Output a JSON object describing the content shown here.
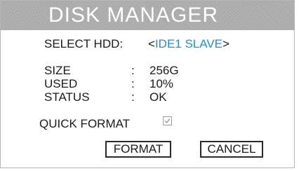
{
  "title": "DISK MANAGER",
  "select_hdd": {
    "label": "SELECT HDD:",
    "bracket_open": "<",
    "value": "IDE1 SLAVE",
    "bracket_close": ">"
  },
  "info": [
    {
      "label": "SIZE",
      "colon": ":",
      "value": "256G"
    },
    {
      "label": "USED",
      "colon": ":",
      "value": "10%"
    },
    {
      "label": "STATUS",
      "colon": ":",
      "value": "OK"
    }
  ],
  "quick_format": {
    "label": "QUICK FORMAT",
    "checked": true
  },
  "buttons": {
    "format": "FORMAT",
    "cancel": "CANCEL"
  },
  "colors": {
    "title_bar": "#a8a8a8",
    "title_text": "#ffffff",
    "highlight": "#1e8fd5"
  }
}
